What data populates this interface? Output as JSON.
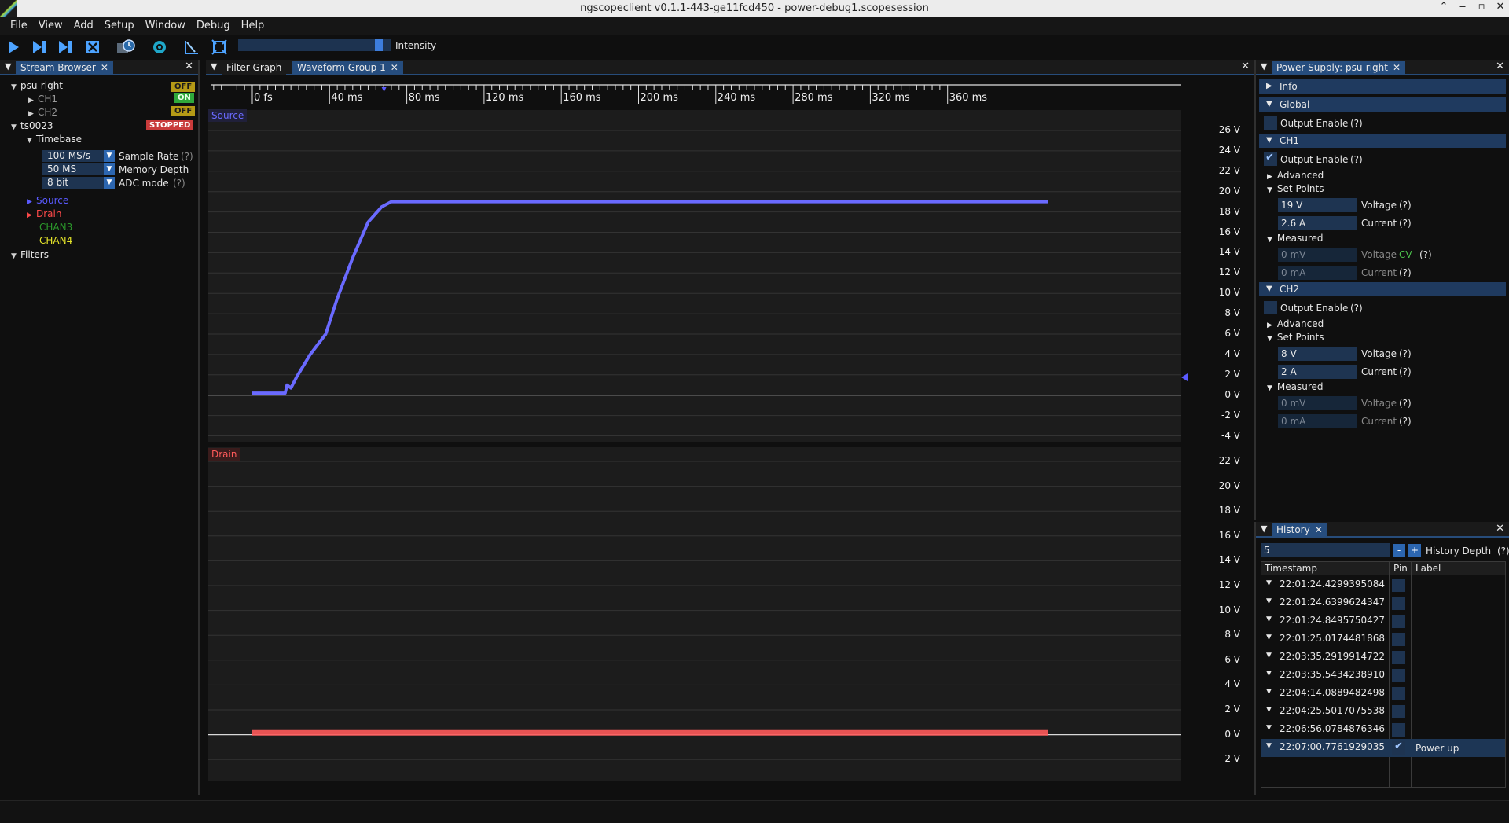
{
  "window": {
    "title": "ngscopeclient v0.1.1-443-ge11fcd450  - power-debug1.scopesession"
  },
  "menubar": [
    "File",
    "View",
    "Add",
    "Setup",
    "Window",
    "Debug",
    "Help"
  ],
  "toolbar": {
    "intensity_label": "Intensity",
    "intensity_level": 0.95
  },
  "stream_browser": {
    "tab": "Stream Browser",
    "psu": {
      "name": "psu-right",
      "status": "OFF",
      "ch1": "CH1",
      "ch1_status": "ON",
      "ch2": "CH2",
      "ch2_status": "OFF"
    },
    "scope": {
      "name": "ts0023",
      "status": "STOPPED",
      "timebase": "Timebase",
      "sample_rate": "100 MS/s",
      "sample_rate_label": "Sample Rate",
      "memory_depth": "50 MS",
      "memory_depth_label": "Memory Depth",
      "adc_mode": "8 bit",
      "adc_mode_label": "ADC mode",
      "help": "(?)",
      "channels": [
        {
          "name": "Source",
          "color": "#5a5aff"
        },
        {
          "name": "Drain",
          "color": "#ff4a4a"
        },
        {
          "name": "CHAN3",
          "color": "#2b9a2b"
        },
        {
          "name": "CHAN4",
          "color": "#e6e62a"
        }
      ]
    },
    "filters": "Filters"
  },
  "waveform": {
    "tabs": [
      "Filter Graph",
      "Waveform Group 1"
    ],
    "time_ticks": [
      "0 fs",
      "40 ms",
      "80 ms",
      "120 ms",
      "160 ms",
      "200 ms",
      "240 ms",
      "280 ms",
      "320 ms",
      "360 ms"
    ],
    "source": {
      "label": "Source",
      "color": "#6a6aff",
      "axis": [
        "26 V",
        "24 V",
        "22 V",
        "20 V",
        "18 V",
        "16 V",
        "14 V",
        "12 V",
        "10 V",
        "8 V",
        "6 V",
        "4 V",
        "2 V",
        "0 V",
        "-2 V",
        "-4 V"
      ]
    },
    "drain": {
      "label": "Drain",
      "color": "#ff5a5a",
      "axis": [
        "22 V",
        "20 V",
        "18 V",
        "16 V",
        "14 V",
        "12 V",
        "10 V",
        "8 V",
        "6 V",
        "4 V",
        "2 V",
        "0 V",
        "-2 V"
      ]
    }
  },
  "psu_panel": {
    "tab": "Power Supply: psu-right",
    "info": "Info",
    "global": "Global",
    "output_enable": "Output Enable",
    "help": "(?)",
    "advanced": "Advanced",
    "set_points": "Set Points",
    "measured": "Measured",
    "voltage": "Voltage",
    "current": "Current",
    "cv": "CV",
    "ch1": {
      "name": "CH1",
      "enabled": true,
      "set_voltage": "19 V",
      "set_current": "2.6 A",
      "meas_voltage": "0 mV",
      "meas_current": "0 mA"
    },
    "ch2": {
      "name": "CH2",
      "enabled": false,
      "set_voltage": "8 V",
      "set_current": "2 A",
      "meas_voltage": "0 mV",
      "meas_current": "0 mA"
    }
  },
  "history": {
    "tab": "History",
    "depth_value": "5",
    "minus": "-",
    "plus": "+",
    "depth_label": "History Depth",
    "help": "(?)",
    "columns": [
      "Timestamp",
      "Pin",
      "Label"
    ],
    "rows": [
      {
        "ts": "22:01:24.4299395084",
        "pinned": false,
        "label": ""
      },
      {
        "ts": "22:01:24.6399624347",
        "pinned": false,
        "label": ""
      },
      {
        "ts": "22:01:24.8495750427",
        "pinned": false,
        "label": ""
      },
      {
        "ts": "22:01:25.0174481868",
        "pinned": false,
        "label": ""
      },
      {
        "ts": "22:03:35.2919914722",
        "pinned": false,
        "label": ""
      },
      {
        "ts": "22:03:35.5434238910",
        "pinned": false,
        "label": ""
      },
      {
        "ts": "22:04:14.0889482498",
        "pinned": false,
        "label": ""
      },
      {
        "ts": "22:04:25.5017075538",
        "pinned": false,
        "label": ""
      },
      {
        "ts": "22:06:56.0784876346",
        "pinned": false,
        "label": ""
      },
      {
        "ts": "22:07:00.7761929035",
        "pinned": true,
        "label": "Power up"
      }
    ]
  }
}
